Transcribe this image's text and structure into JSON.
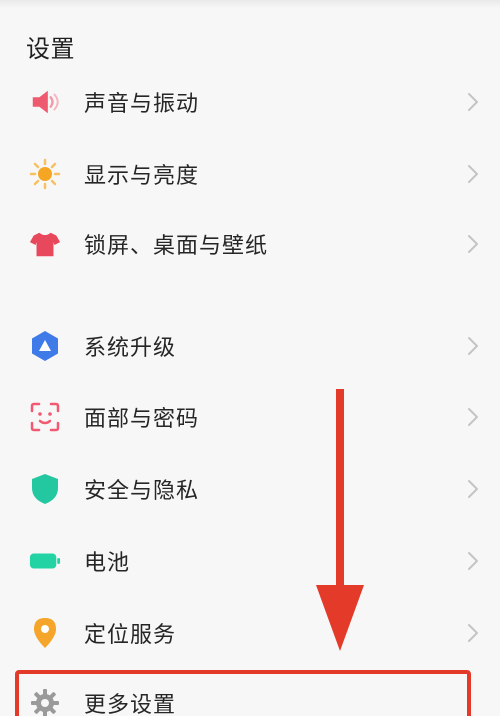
{
  "page": {
    "title": "设置"
  },
  "items": [
    {
      "label": "声音与振动",
      "icon": "speaker-icon",
      "color": "#ee5a6f"
    },
    {
      "label": "显示与亮度",
      "icon": "sun-icon",
      "color": "#f5a623"
    },
    {
      "label": "锁屏、桌面与壁纸",
      "icon": "tshirt-icon",
      "color": "#e8485c"
    },
    {
      "label": "系统升级",
      "icon": "upgrade-icon",
      "color": "#3f7be8"
    },
    {
      "label": "面部与密码",
      "icon": "face-scan-icon",
      "color": "#f25a72"
    },
    {
      "label": "安全与隐私",
      "icon": "shield-icon",
      "color": "#23c8a0"
    },
    {
      "label": "电池",
      "icon": "battery-icon",
      "color": "#23d3a3"
    },
    {
      "label": "定位服务",
      "icon": "location-pin-icon",
      "color": "#f4a52a"
    },
    {
      "label": "更多设置",
      "icon": "gear-icon",
      "color": "#9a9a9a"
    }
  ],
  "annotation": {
    "arrow_color": "#e33a2a",
    "highlight_color": "#e33a2a"
  }
}
